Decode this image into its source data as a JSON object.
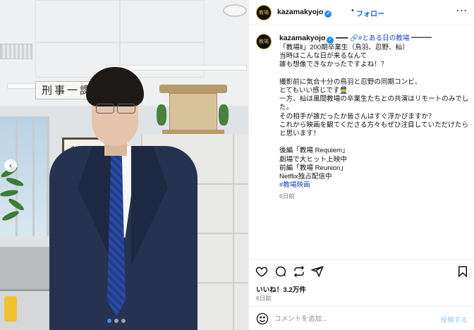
{
  "accent_color": "#0a66d8",
  "hashtag_color": "#1d3fbf",
  "post_image": {
    "sign_text": "刑事一課",
    "calligraphy_text": "新巣気",
    "carousel_total": 3,
    "carousel_active": 1
  },
  "header": {
    "username": "kazamakyojo",
    "verified_icon": "verified-badge-icon",
    "separator": "•",
    "follow_label": "フォロー",
    "more_icon": "more-options-icon"
  },
  "caption": {
    "avatar_text": "教場",
    "username": "kazamakyojo",
    "lines": [
      {
        "text": "━━━ 🔗",
        "tag": "#とある日の教場",
        "after": " ━━━"
      },
      {
        "text": "「教場Ⅱ」200期卒業生（鳥羽、忍野、杣）"
      },
      {
        "text": "当時はこんな日が来るなんて"
      },
      {
        "text": "誰も想像できなかったですよね！？"
      },
      {
        "gap": true
      },
      {
        "text": "撮影前に気合十分の鳥羽と忍野の同期コンビ、"
      },
      {
        "text": "とてもいい感じです👮"
      },
      {
        "text": "一方、杣は風間教場の卒業生たちとの共演はリモートのみでし"
      },
      {
        "text": "た。"
      },
      {
        "text": "その相手が誰だったか皆さんはすぐ浮かびますか？"
      },
      {
        "text": "これから映画を観てくださる方々もぜひ注目していただけたら"
      },
      {
        "text": "と思います！"
      },
      {
        "gap": true
      },
      {
        "text": "後編「教場 Requiem」"
      },
      {
        "text": "劇場で大ヒット上映中"
      },
      {
        "text": "前編「教場 Reunion」"
      },
      {
        "text": "Netflix独占配信中"
      },
      {
        "tag": "#教場映画"
      }
    ],
    "time_ago": "6日前"
  },
  "actions": {
    "like_icon": "heart-icon",
    "comment_icon": "comment-icon",
    "share_icon": "repost-icon",
    "send_icon": "send-icon",
    "save_icon": "bookmark-icon"
  },
  "likes_text": "いいね！3.2万件",
  "post_time_ago": "6日前",
  "comment": {
    "emoji_icon": "emoji-icon",
    "placeholder": "コメントを追加...",
    "post_label": "投稿する"
  }
}
